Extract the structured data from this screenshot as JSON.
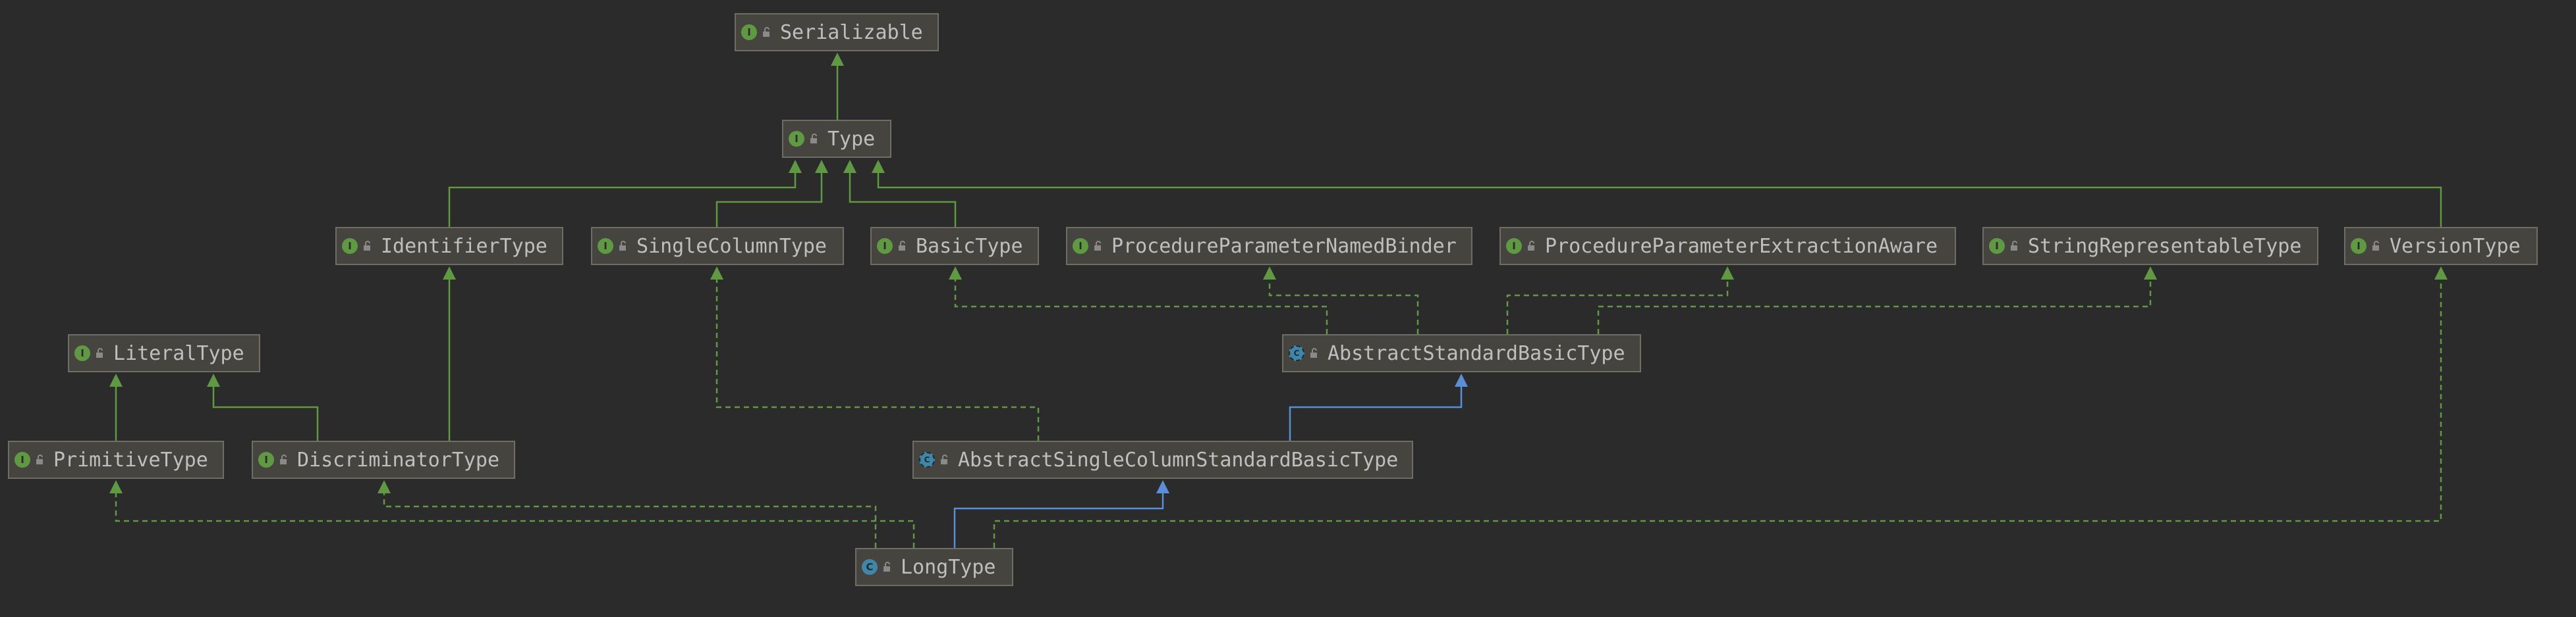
{
  "colors": {
    "background": "#2b2b2b",
    "node_fill": "#45443e",
    "node_border": "#6e6d66",
    "text": "#bfbfbf",
    "interface_edge": "#5f9a43",
    "extends_edge": "#5a8fd8"
  },
  "nodes": {
    "serializable": {
      "label": "Serializable",
      "kind": "interface"
    },
    "type": {
      "label": "Type",
      "kind": "interface"
    },
    "identifier_type": {
      "label": "IdentifierType",
      "kind": "interface"
    },
    "single_column_type": {
      "label": "SingleColumnType",
      "kind": "interface"
    },
    "basic_type": {
      "label": "BasicType",
      "kind": "interface"
    },
    "procedure_parameter_named_binder": {
      "label": "ProcedureParameterNamedBinder",
      "kind": "interface"
    },
    "procedure_parameter_extraction_aware": {
      "label": "ProcedureParameterExtractionAware",
      "kind": "interface"
    },
    "string_representable_type": {
      "label": "StringRepresentableType",
      "kind": "interface"
    },
    "version_type": {
      "label": "VersionType",
      "kind": "interface"
    },
    "literal_type": {
      "label": "LiteralType",
      "kind": "interface"
    },
    "abstract_standard_basic_type": {
      "label": "AbstractStandardBasicType",
      "kind": "abstract-class"
    },
    "primitive_type": {
      "label": "PrimitiveType",
      "kind": "interface"
    },
    "discriminator_type": {
      "label": "DiscriminatorType",
      "kind": "interface"
    },
    "abstract_single_column_standard_basic_type": {
      "label": "AbstractSingleColumnStandardBasicType",
      "kind": "abstract-class"
    },
    "long_type": {
      "label": "LongType",
      "kind": "class"
    }
  },
  "edges": [
    {
      "from": "type",
      "to": "serializable",
      "relation": "interface-extends"
    },
    {
      "from": "identifier_type",
      "to": "type",
      "relation": "interface-extends"
    },
    {
      "from": "single_column_type",
      "to": "type",
      "relation": "interface-extends"
    },
    {
      "from": "basic_type",
      "to": "type",
      "relation": "interface-extends"
    },
    {
      "from": "version_type",
      "to": "type",
      "relation": "interface-extends"
    },
    {
      "from": "discriminator_type",
      "to": "identifier_type",
      "relation": "interface-extends"
    },
    {
      "from": "discriminator_type",
      "to": "literal_type",
      "relation": "interface-extends"
    },
    {
      "from": "primitive_type",
      "to": "literal_type",
      "relation": "interface-extends"
    },
    {
      "from": "abstract_standard_basic_type",
      "to": "basic_type",
      "relation": "implements"
    },
    {
      "from": "abstract_standard_basic_type",
      "to": "procedure_parameter_named_binder",
      "relation": "implements"
    },
    {
      "from": "abstract_standard_basic_type",
      "to": "procedure_parameter_extraction_aware",
      "relation": "implements"
    },
    {
      "from": "abstract_standard_basic_type",
      "to": "string_representable_type",
      "relation": "implements"
    },
    {
      "from": "abstract_single_column_standard_basic_type",
      "to": "abstract_standard_basic_type",
      "relation": "extends"
    },
    {
      "from": "abstract_single_column_standard_basic_type",
      "to": "single_column_type",
      "relation": "implements"
    },
    {
      "from": "long_type",
      "to": "abstract_single_column_standard_basic_type",
      "relation": "extends"
    },
    {
      "from": "long_type",
      "to": "primitive_type",
      "relation": "implements"
    },
    {
      "from": "long_type",
      "to": "discriminator_type",
      "relation": "implements"
    },
    {
      "from": "long_type",
      "to": "version_type",
      "relation": "implements"
    }
  ]
}
